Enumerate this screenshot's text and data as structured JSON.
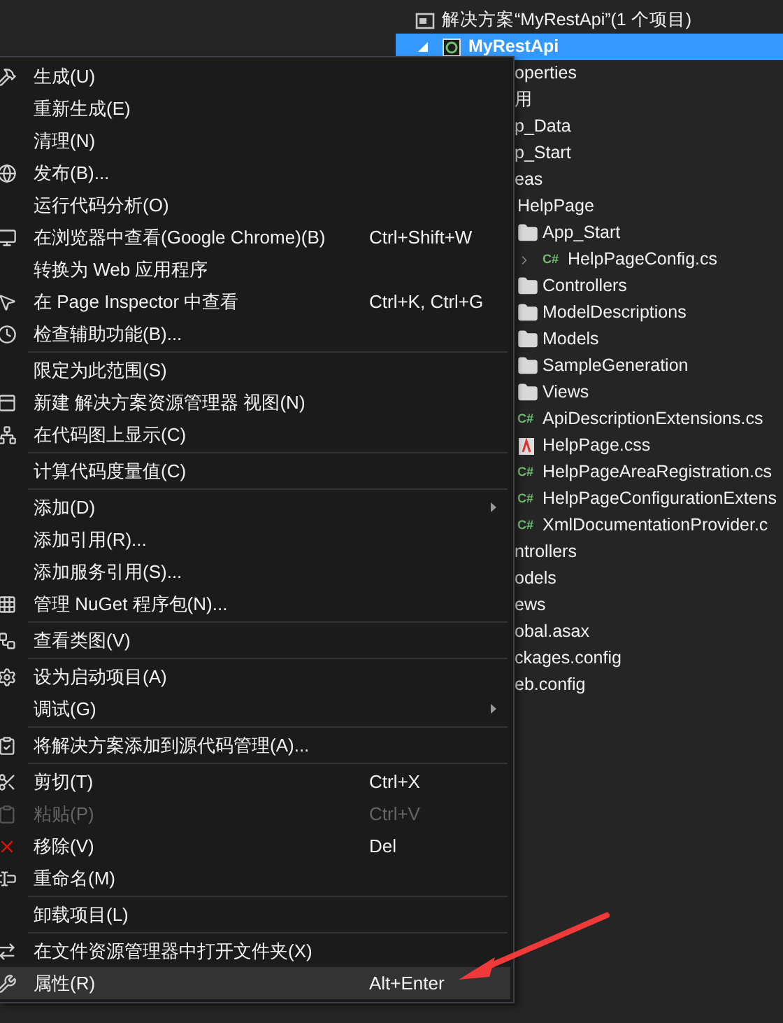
{
  "solution_explorer": {
    "tree": [
      {
        "label": "解决方案“MyRestApi”(1 个项目)",
        "kind": "solution",
        "selected": false,
        "children": [
          {
            "label": "MyRestApi",
            "kind": "project",
            "selected": true,
            "expanded": true,
            "children": [
              {
                "label": "operties",
                "selected": false
              },
              {
                "label": "用",
                "selected": false
              },
              {
                "label": "p_Data",
                "selected": false
              },
              {
                "label": "p_Start",
                "selected": false
              },
              {
                "label": "eas",
                "selected": false,
                "children": [
                  {
                    "label": "HelpPage",
                    "selected": false,
                    "children": [
                      {
                        "label": "App_Start",
                        "kind": "folder",
                        "selected": false,
                        "children": [
                          {
                            "label": "HelpPageConfig.cs",
                            "kind": "csharp",
                            "icon_text": "C#",
                            "selected": false,
                            "expanded": false
                          }
                        ]
                      },
                      {
                        "label": "Controllers",
                        "kind": "folder",
                        "selected": false
                      },
                      {
                        "label": "ModelDescriptions",
                        "kind": "folder",
                        "selected": false
                      },
                      {
                        "label": "Models",
                        "kind": "folder",
                        "selected": false
                      },
                      {
                        "label": "SampleGeneration",
                        "kind": "folder",
                        "selected": false
                      },
                      {
                        "label": "Views",
                        "kind": "folder",
                        "selected": false
                      },
                      {
                        "label": "ApiDescriptionExtensions.cs",
                        "kind": "csharp",
                        "icon_text": "C#",
                        "selected": false
                      },
                      {
                        "label": "HelpPage.css",
                        "kind": "css",
                        "selected": false
                      },
                      {
                        "label": "HelpPageAreaRegistration.cs",
                        "kind": "csharp",
                        "icon_text": "C#",
                        "selected": false
                      },
                      {
                        "label": "HelpPageConfigurationExtens",
                        "kind": "csharp",
                        "icon_text": "C#",
                        "selected": false
                      },
                      {
                        "label": "XmlDocumentationProvider.c",
                        "kind": "csharp",
                        "icon_text": "C#",
                        "selected": false
                      }
                    ]
                  }
                ]
              },
              {
                "label": "ntrollers",
                "selected": false
              },
              {
                "label": "odels",
                "selected": false
              },
              {
                "label": "ews",
                "selected": false
              },
              {
                "label": "obal.asax",
                "selected": false
              },
              {
                "label": "ckages.config",
                "selected": false
              },
              {
                "label": "eb.config",
                "selected": false
              }
            ]
          }
        ]
      }
    ]
  },
  "context_menu": {
    "groups": [
      {
        "items": [
          {
            "label": "生成(U)",
            "selected": false,
            "disabled": false,
            "has_submenu": false
          },
          {
            "label": "重新生成(E)",
            "selected": false,
            "disabled": false,
            "has_submenu": false
          },
          {
            "label": "清理(N)",
            "selected": false,
            "disabled": false,
            "has_submenu": false
          },
          {
            "label": "发布(B)...",
            "selected": false,
            "disabled": false,
            "has_submenu": false
          },
          {
            "label": "运行代码分析(O)",
            "selected": false,
            "disabled": false,
            "has_submenu": false
          },
          {
            "label": "在浏览器中查看(Google Chrome)(B)",
            "shortcut": "Ctrl+Shift+W",
            "selected": false,
            "disabled": false,
            "has_submenu": false
          },
          {
            "label": "转换为 Web 应用程序",
            "selected": false,
            "disabled": false,
            "has_submenu": false
          },
          {
            "label": "在 Page Inspector 中查看",
            "shortcut": "Ctrl+K, Ctrl+G",
            "selected": false,
            "disabled": false,
            "has_submenu": false
          },
          {
            "label": "检查辅助功能(B)...",
            "selected": false,
            "disabled": false,
            "has_submenu": false
          }
        ]
      },
      {
        "items": [
          {
            "label": "限定为此范围(S)",
            "selected": false,
            "disabled": false,
            "has_submenu": false
          },
          {
            "label": "新建 解决方案资源管理器 视图(N)",
            "selected": false,
            "disabled": false,
            "has_submenu": false
          },
          {
            "label": "在代码图上显示(C)",
            "selected": false,
            "disabled": false,
            "has_submenu": false
          }
        ]
      },
      {
        "items": [
          {
            "label": "计算代码度量值(C)",
            "selected": false,
            "disabled": false,
            "has_submenu": false
          }
        ]
      },
      {
        "items": [
          {
            "label": "添加(D)",
            "selected": false,
            "disabled": false,
            "has_submenu": true
          },
          {
            "label": "添加引用(R)...",
            "selected": false,
            "disabled": false,
            "has_submenu": false
          },
          {
            "label": "添加服务引用(S)...",
            "selected": false,
            "disabled": false,
            "has_submenu": false
          },
          {
            "label": "管理 NuGet 程序包(N)...",
            "selected": false,
            "disabled": false,
            "has_submenu": false
          }
        ]
      },
      {
        "items": [
          {
            "label": "查看类图(V)",
            "selected": false,
            "disabled": false,
            "has_submenu": false
          }
        ]
      },
      {
        "items": [
          {
            "label": "设为启动项目(A)",
            "selected": false,
            "disabled": false,
            "has_submenu": false
          },
          {
            "label": "调试(G)",
            "selected": false,
            "disabled": false,
            "has_submenu": true
          }
        ]
      },
      {
        "items": [
          {
            "label": "将解决方案添加到源代码管理(A)...",
            "selected": false,
            "disabled": false,
            "has_submenu": false
          }
        ]
      },
      {
        "items": [
          {
            "label": "剪切(T)",
            "shortcut": "Ctrl+X",
            "selected": false,
            "disabled": false,
            "has_submenu": false
          },
          {
            "label": "粘贴(P)",
            "shortcut": "Ctrl+V",
            "selected": false,
            "disabled": true,
            "has_submenu": false
          },
          {
            "label": "移除(V)",
            "shortcut": "Del",
            "selected": false,
            "disabled": false,
            "has_submenu": false
          },
          {
            "label": "重命名(M)",
            "selected": false,
            "disabled": false,
            "has_submenu": false
          }
        ]
      },
      {
        "items": [
          {
            "label": "卸载项目(L)",
            "selected": false,
            "disabled": false,
            "has_submenu": false
          }
        ]
      },
      {
        "items": [
          {
            "label": "在文件资源管理器中打开文件夹(X)",
            "selected": false,
            "disabled": false,
            "has_submenu": false
          },
          {
            "label": "属性(R)",
            "shortcut": "Alt+Enter",
            "selected": true,
            "disabled": false,
            "has_submenu": false
          }
        ]
      }
    ]
  }
}
